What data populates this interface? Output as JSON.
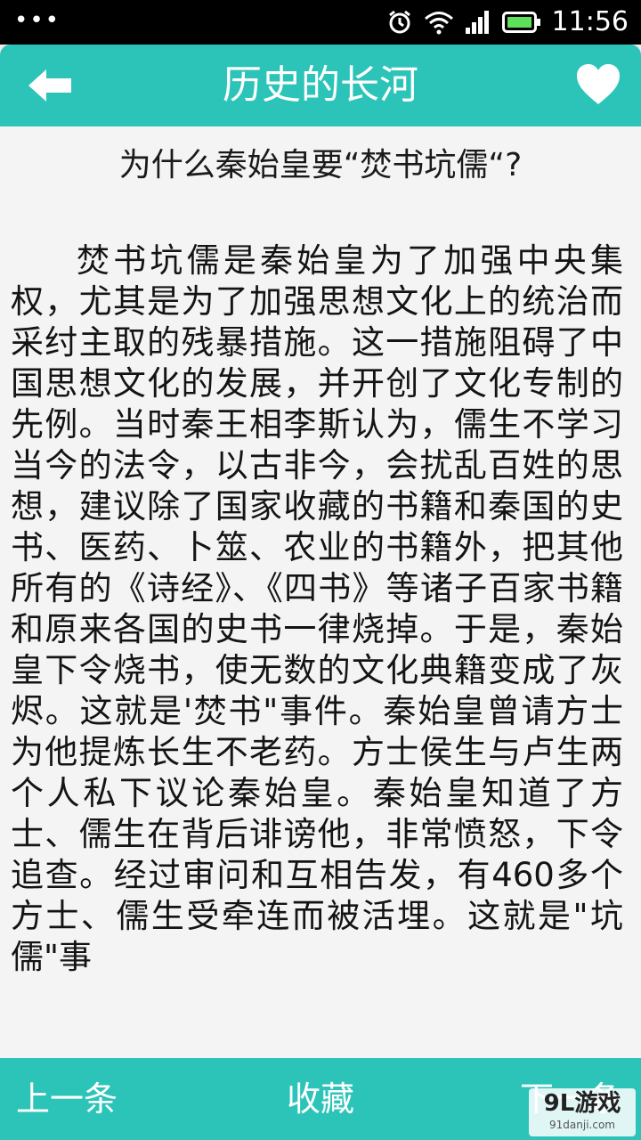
{
  "status_bar": {
    "dots": "•••",
    "time": "11:56",
    "icons": [
      "alarm-icon",
      "wifi-icon",
      "signal-icon",
      "battery-icon"
    ]
  },
  "app_bar": {
    "title": "历史的长河",
    "back_icon": "back-arrow-icon",
    "favorite_icon": "heart-icon"
  },
  "article": {
    "title": "为什么秦始皇要“焚书坑儒“?",
    "body": "焚书坑儒是秦始皇为了加强中央集权，尤其是为了加强思想文化上的统治而采纣主取的残暴措施。这一措施阻碍了中国思想文化的发展，并开创了文化专制的先例。当时秦王相李斯认为，儒生不学习当今的法令，以古非今，会扰乱百姓的思想，建议除了国家收藏的书籍和秦国的史书、医药、卜筮、农业的书籍外，把其他所有的《诗经》、《四书》等诸子百家书籍和原来各国的史书一律烧掉。于是，秦始皇下令烧书，使无数的文化典籍变成了灰烬。这就是'焚书\"事件。秦始皇曾请方士为他提炼长生不老药。方士侯生与卢生两个人私下议论秦始皇。秦始皇知道了方士、儒生在背后诽谤他，非常愤怒，下令追查。经过审问和互相告发，有460多个方士、儒生受牵连而被活埋。这就是\"坑儒\"事"
  },
  "bottom_bar": {
    "prev_label": "上一条",
    "favorite_label": "收藏",
    "next_label": "下一条"
  },
  "watermark": {
    "main": "9L游戏",
    "sub": "91danji.com"
  },
  "colors": {
    "accent": "#2cc4b8",
    "background": "#f4f4f4",
    "text": "#141414"
  }
}
